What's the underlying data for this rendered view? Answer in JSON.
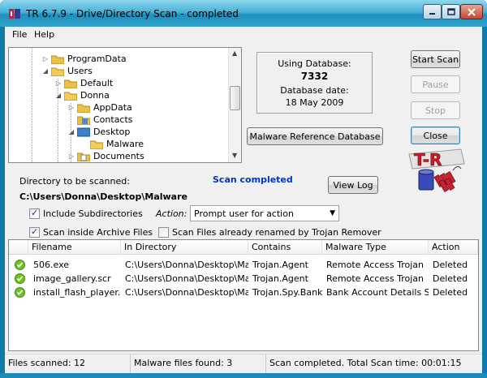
{
  "window": {
    "title": "TR 6.7.9  -  Drive/Directory Scan - completed"
  },
  "menu": {
    "items": [
      "File",
      "Help"
    ]
  },
  "tree": {
    "items": [
      {
        "label": "ProgramData",
        "expanded": false
      },
      {
        "label": "Users",
        "expanded": true
      },
      {
        "label": "Default",
        "expanded": false
      },
      {
        "label": "Donna",
        "expanded": true
      },
      {
        "label": "AppData",
        "expanded": false
      },
      {
        "label": "Contacts",
        "expanded": false
      },
      {
        "label": "Desktop",
        "expanded": true
      },
      {
        "label": "Malware",
        "expanded": false
      },
      {
        "label": "Documents",
        "expanded": false
      }
    ]
  },
  "database": {
    "label": "Using Database:",
    "value": "7332",
    "date_label": "Database date:",
    "date": "18 May 2009"
  },
  "buttons": {
    "malware_ref": "Malware Reference Database",
    "start_scan": "Start Scan",
    "pause": "Pause",
    "stop": "Stop",
    "close": "Close",
    "view_log": "View Log"
  },
  "logo": {
    "text": "T-R"
  },
  "scan": {
    "dir_label": "Directory to be scanned:",
    "dir_path": "C:\\Users\\Donna\\Desktop\\Malware",
    "status": "Scan completed"
  },
  "options": {
    "include_subdirs": "Include Subdirectories",
    "include_subdirs_checked": true,
    "action_label": "Action:",
    "action_value": "Prompt user for action",
    "scan_archives": "Scan inside Archive Files",
    "scan_archives_checked": true,
    "scan_renamed": "Scan Files already renamed by Trojan Remover",
    "scan_renamed_checked": false
  },
  "results": {
    "columns": [
      "Filename",
      "In Directory",
      "Contains",
      "Malware Type",
      "Action"
    ],
    "rows": [
      [
        "506.exe",
        "C:\\Users\\Donna\\Desktop\\Malware\\",
        "Trojan.Agent",
        "Remote Access Trojan",
        "Deleted"
      ],
      [
        "image_gallery.scr",
        "C:\\Users\\Donna\\Desktop\\Malware\\",
        "Trojan.Agent",
        "Remote Access Trojan",
        "Deleted"
      ],
      [
        "install_flash_player.exe",
        "C:\\Users\\Donna\\Desktop\\Malware\\",
        "Trojan.Spy.Banker",
        "Bank Account Details Stealer",
        "Deleted"
      ]
    ]
  },
  "status": {
    "files_scanned": "Files scanned: 12",
    "malware_found": "Malware files found: 3",
    "summary": "Scan completed. Total Scan time: 00:01:15"
  },
  "colors": {
    "accent": "#0033cc",
    "titlebar": "#49b2d6",
    "ok": "#5bb318"
  }
}
